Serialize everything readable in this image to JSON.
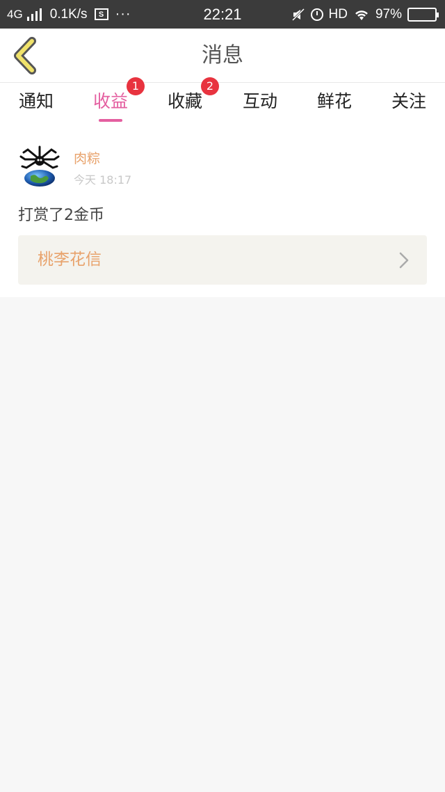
{
  "statusbar": {
    "network": "4G",
    "speed": "0.1K/s",
    "screenshot_icon": "S",
    "more": "···",
    "time": "22:21",
    "hd": "HD",
    "battery": "97%"
  },
  "header": {
    "title": "消息"
  },
  "tabs": [
    {
      "label": "通知",
      "badge": ""
    },
    {
      "label": "收益",
      "badge": "1",
      "active": true
    },
    {
      "label": "收藏",
      "badge": "2"
    },
    {
      "label": "互动",
      "badge": ""
    },
    {
      "label": "鲜花",
      "badge": ""
    },
    {
      "label": "关注",
      "badge": ""
    }
  ],
  "colors": {
    "accent_pink": "#e45fa0",
    "orange": "#e8a26b",
    "badge_red": "#e8333f"
  },
  "message": {
    "username": "肉粽",
    "time": "今天 18:17",
    "text": "打赏了2金币",
    "book_title": "桃李花信",
    "avatar_icon": "spider-earth-avatar",
    "chevron_icon": "chevron-right-icon"
  }
}
